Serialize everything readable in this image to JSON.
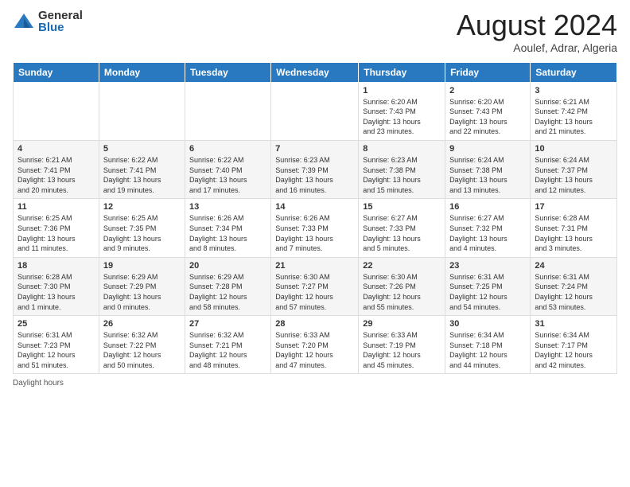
{
  "logo": {
    "general": "General",
    "blue": "Blue"
  },
  "header": {
    "month_year": "August 2024",
    "location": "Aoulef, Adrar, Algeria"
  },
  "weekdays": [
    "Sunday",
    "Monday",
    "Tuesday",
    "Wednesday",
    "Thursday",
    "Friday",
    "Saturday"
  ],
  "footer": {
    "label": "Daylight hours"
  },
  "weeks": [
    [
      {
        "day": "",
        "info": ""
      },
      {
        "day": "",
        "info": ""
      },
      {
        "day": "",
        "info": ""
      },
      {
        "day": "",
        "info": ""
      },
      {
        "day": "1",
        "info": "Sunrise: 6:20 AM\nSunset: 7:43 PM\nDaylight: 13 hours\nand 23 minutes."
      },
      {
        "day": "2",
        "info": "Sunrise: 6:20 AM\nSunset: 7:43 PM\nDaylight: 13 hours\nand 22 minutes."
      },
      {
        "day": "3",
        "info": "Sunrise: 6:21 AM\nSunset: 7:42 PM\nDaylight: 13 hours\nand 21 minutes."
      }
    ],
    [
      {
        "day": "4",
        "info": "Sunrise: 6:21 AM\nSunset: 7:41 PM\nDaylight: 13 hours\nand 20 minutes."
      },
      {
        "day": "5",
        "info": "Sunrise: 6:22 AM\nSunset: 7:41 PM\nDaylight: 13 hours\nand 19 minutes."
      },
      {
        "day": "6",
        "info": "Sunrise: 6:22 AM\nSunset: 7:40 PM\nDaylight: 13 hours\nand 17 minutes."
      },
      {
        "day": "7",
        "info": "Sunrise: 6:23 AM\nSunset: 7:39 PM\nDaylight: 13 hours\nand 16 minutes."
      },
      {
        "day": "8",
        "info": "Sunrise: 6:23 AM\nSunset: 7:38 PM\nDaylight: 13 hours\nand 15 minutes."
      },
      {
        "day": "9",
        "info": "Sunrise: 6:24 AM\nSunset: 7:38 PM\nDaylight: 13 hours\nand 13 minutes."
      },
      {
        "day": "10",
        "info": "Sunrise: 6:24 AM\nSunset: 7:37 PM\nDaylight: 13 hours\nand 12 minutes."
      }
    ],
    [
      {
        "day": "11",
        "info": "Sunrise: 6:25 AM\nSunset: 7:36 PM\nDaylight: 13 hours\nand 11 minutes."
      },
      {
        "day": "12",
        "info": "Sunrise: 6:25 AM\nSunset: 7:35 PM\nDaylight: 13 hours\nand 9 minutes."
      },
      {
        "day": "13",
        "info": "Sunrise: 6:26 AM\nSunset: 7:34 PM\nDaylight: 13 hours\nand 8 minutes."
      },
      {
        "day": "14",
        "info": "Sunrise: 6:26 AM\nSunset: 7:33 PM\nDaylight: 13 hours\nand 7 minutes."
      },
      {
        "day": "15",
        "info": "Sunrise: 6:27 AM\nSunset: 7:33 PM\nDaylight: 13 hours\nand 5 minutes."
      },
      {
        "day": "16",
        "info": "Sunrise: 6:27 AM\nSunset: 7:32 PM\nDaylight: 13 hours\nand 4 minutes."
      },
      {
        "day": "17",
        "info": "Sunrise: 6:28 AM\nSunset: 7:31 PM\nDaylight: 13 hours\nand 3 minutes."
      }
    ],
    [
      {
        "day": "18",
        "info": "Sunrise: 6:28 AM\nSunset: 7:30 PM\nDaylight: 13 hours\nand 1 minute."
      },
      {
        "day": "19",
        "info": "Sunrise: 6:29 AM\nSunset: 7:29 PM\nDaylight: 13 hours\nand 0 minutes."
      },
      {
        "day": "20",
        "info": "Sunrise: 6:29 AM\nSunset: 7:28 PM\nDaylight: 12 hours\nand 58 minutes."
      },
      {
        "day": "21",
        "info": "Sunrise: 6:30 AM\nSunset: 7:27 PM\nDaylight: 12 hours\nand 57 minutes."
      },
      {
        "day": "22",
        "info": "Sunrise: 6:30 AM\nSunset: 7:26 PM\nDaylight: 12 hours\nand 55 minutes."
      },
      {
        "day": "23",
        "info": "Sunrise: 6:31 AM\nSunset: 7:25 PM\nDaylight: 12 hours\nand 54 minutes."
      },
      {
        "day": "24",
        "info": "Sunrise: 6:31 AM\nSunset: 7:24 PM\nDaylight: 12 hours\nand 53 minutes."
      }
    ],
    [
      {
        "day": "25",
        "info": "Sunrise: 6:31 AM\nSunset: 7:23 PM\nDaylight: 12 hours\nand 51 minutes."
      },
      {
        "day": "26",
        "info": "Sunrise: 6:32 AM\nSunset: 7:22 PM\nDaylight: 12 hours\nand 50 minutes."
      },
      {
        "day": "27",
        "info": "Sunrise: 6:32 AM\nSunset: 7:21 PM\nDaylight: 12 hours\nand 48 minutes."
      },
      {
        "day": "28",
        "info": "Sunrise: 6:33 AM\nSunset: 7:20 PM\nDaylight: 12 hours\nand 47 minutes."
      },
      {
        "day": "29",
        "info": "Sunrise: 6:33 AM\nSunset: 7:19 PM\nDaylight: 12 hours\nand 45 minutes."
      },
      {
        "day": "30",
        "info": "Sunrise: 6:34 AM\nSunset: 7:18 PM\nDaylight: 12 hours\nand 44 minutes."
      },
      {
        "day": "31",
        "info": "Sunrise: 6:34 AM\nSunset: 7:17 PM\nDaylight: 12 hours\nand 42 minutes."
      }
    ]
  ]
}
